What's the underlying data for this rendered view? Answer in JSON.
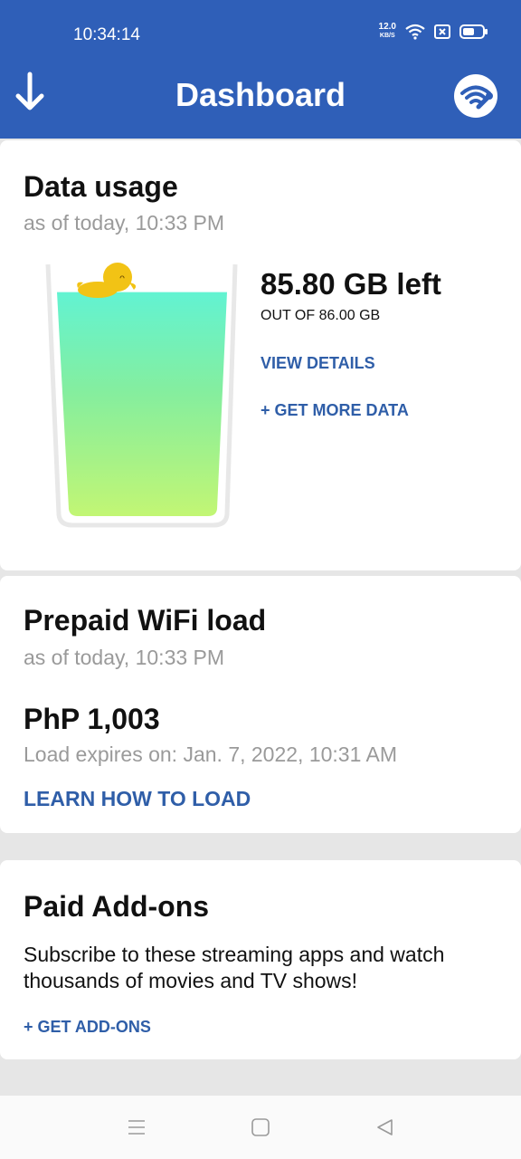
{
  "status_bar": {
    "time": "10:34:14",
    "speed_value": "12.0",
    "speed_unit": "KB/S"
  },
  "header": {
    "title": "Dashboard",
    "back_icon": "arrow-down-icon",
    "action_icon": "wifi-tool-icon",
    "bg_color": "#2f5fb8"
  },
  "data_usage": {
    "title": "Data usage",
    "as_of": "as of today, 10:33 PM",
    "remaining": "85.80 GB left",
    "total": "OUT OF 86.00 GB",
    "view_details": "VIEW DETAILS",
    "get_more": "+ GET MORE DATA",
    "fill_fraction": 0.9977
  },
  "prepaid": {
    "title": "Prepaid WiFi load",
    "as_of": "as of today, 10:33 PM",
    "amount": "PhP 1,003",
    "expires": "Load expires on: Jan. 7, 2022, 10:31 AM",
    "learn": "LEARN HOW TO LOAD"
  },
  "addons": {
    "title": "Paid Add-ons",
    "description": "Subscribe to these streaming apps and watch thousands of movies and TV shows!",
    "get_addons": "+ GET ADD-ONS"
  },
  "accent_color": "#2f5ea8"
}
